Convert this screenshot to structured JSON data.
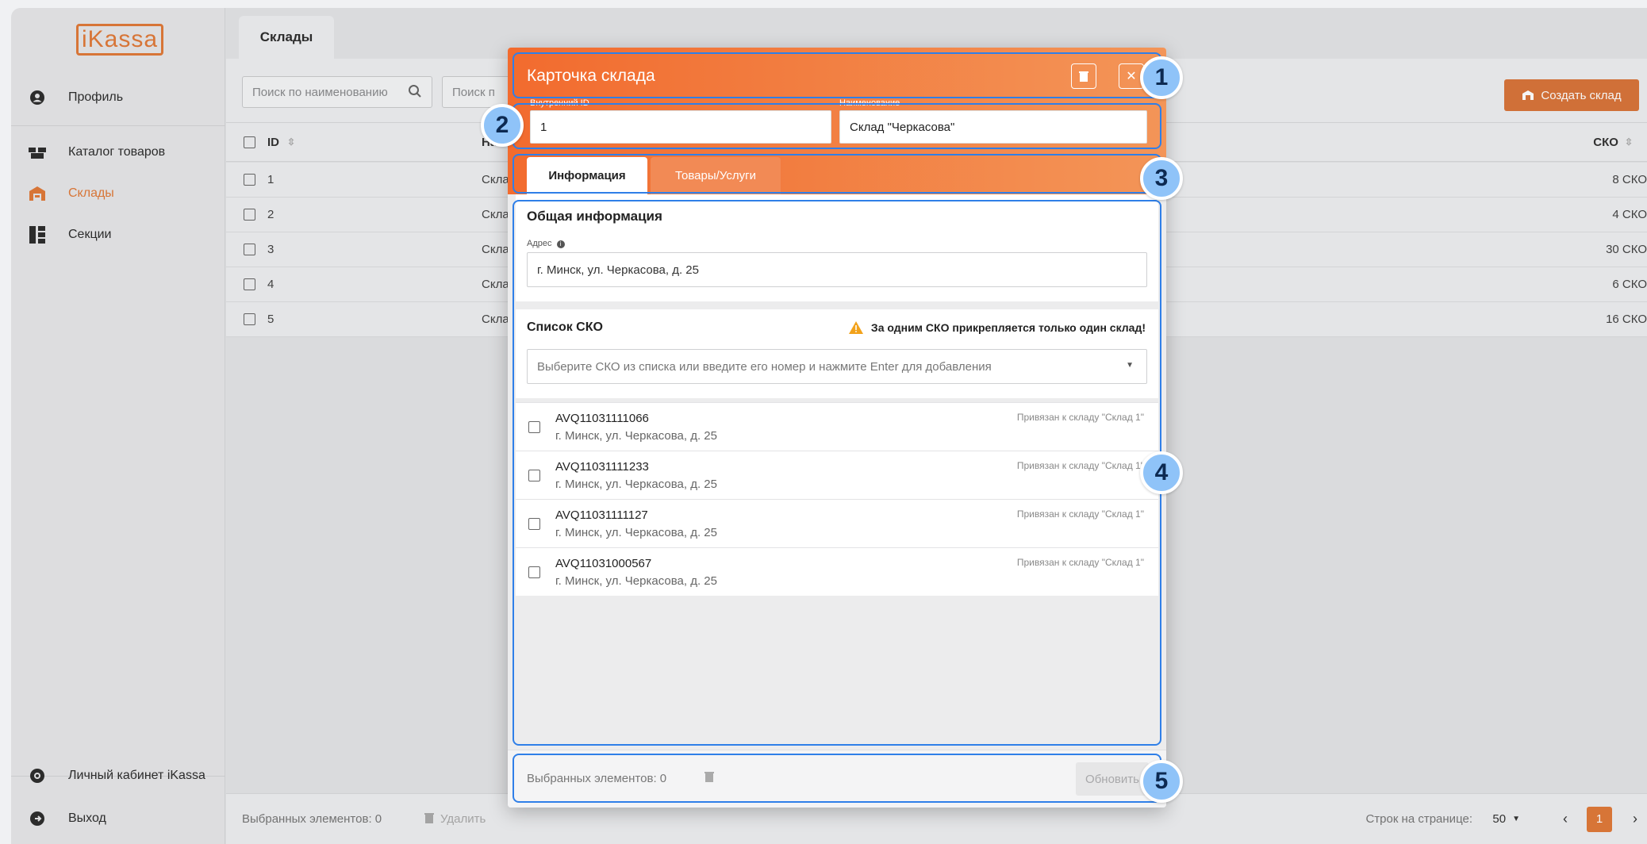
{
  "app": {
    "logo": "iKassa",
    "page_tab": "Склады"
  },
  "sidebar": {
    "items": [
      {
        "label": "Профиль",
        "icon": "user-circle-icon"
      },
      {
        "label": "Каталог товаров",
        "icon": "boxes-icon"
      },
      {
        "label": "Склады",
        "icon": "warehouse-icon",
        "active": true
      },
      {
        "label": "Секции",
        "icon": "sections-icon"
      }
    ],
    "bottom": [
      {
        "label": "Личный кабинет iKassa",
        "icon": "cabinet-icon"
      },
      {
        "label": "Выход",
        "icon": "logout-icon"
      }
    ]
  },
  "toolbar": {
    "search_name_placeholder": "Поиск по наименованию",
    "search2_placeholder": "Поиск п",
    "create_label": "Создать склад"
  },
  "table": {
    "columns": {
      "id": "ID",
      "name": "На",
      "sko": "СКО"
    },
    "rows": [
      {
        "id": "1",
        "name": "Склад",
        "sko": "8 СКО"
      },
      {
        "id": "2",
        "name": "Склад",
        "sko": "4 СКО"
      },
      {
        "id": "3",
        "name": "Склад",
        "sko": "30 СКО"
      },
      {
        "id": "4",
        "name": "Склад",
        "sko": "6 СКО"
      },
      {
        "id": "5",
        "name": "Склад",
        "sko": "16 СКО"
      }
    ],
    "footer": {
      "selected": "Выбранных элементов: 0",
      "delete": "Удалить",
      "rows_per_page_label": "Строк на странице:",
      "rows_per_page": "50",
      "page": "1"
    }
  },
  "modal": {
    "title": "Карточка склада",
    "internal_id_label": "Внутренний ID",
    "internal_id_value": "1",
    "name_label": "Наименование",
    "name_value": "Склад \"Черкасова\"",
    "tabs": [
      "Информация",
      "Товары/Услуги"
    ],
    "general_title": "Общая информация",
    "address_label": "Адрес",
    "address_value": "г. Минск, ул. Черкасова, д. 25",
    "sko_title": "Список СКО",
    "warning": "За одним СКО прикрепляется только один склад!",
    "sko_placeholder": "Выберите СКО из списка или введите его номер и нажмите Enter для добавления",
    "sko_items": [
      {
        "number": "AVQ11031111066",
        "address": "г. Минск, ул. Черкасова, д. 25",
        "bound": "Привязан к складу \"Склад 1\""
      },
      {
        "number": "AVQ11031111233",
        "address": "г. Минск, ул. Черкасова, д. 25",
        "bound": "Привязан к складу \"Склад 1\""
      },
      {
        "number": "AVQ11031111127",
        "address": "г. Минск, ул. Черкасова, д. 25",
        "bound": "Привязан к складу \"Склад 1\""
      },
      {
        "number": "AVQ11031000567",
        "address": "г. Минск, ул. Черкасова, д. 25",
        "bound": "Привязан к складу \"Склад 1\""
      }
    ],
    "footer_selected": "Выбранных элементов: 0",
    "update_label": "Обновить"
  },
  "callouts": [
    "1",
    "2",
    "3",
    "4",
    "5"
  ],
  "colors": {
    "accent": "#f26b2e",
    "callout": "#2f7fe8",
    "badge": "#8fc3f8"
  }
}
